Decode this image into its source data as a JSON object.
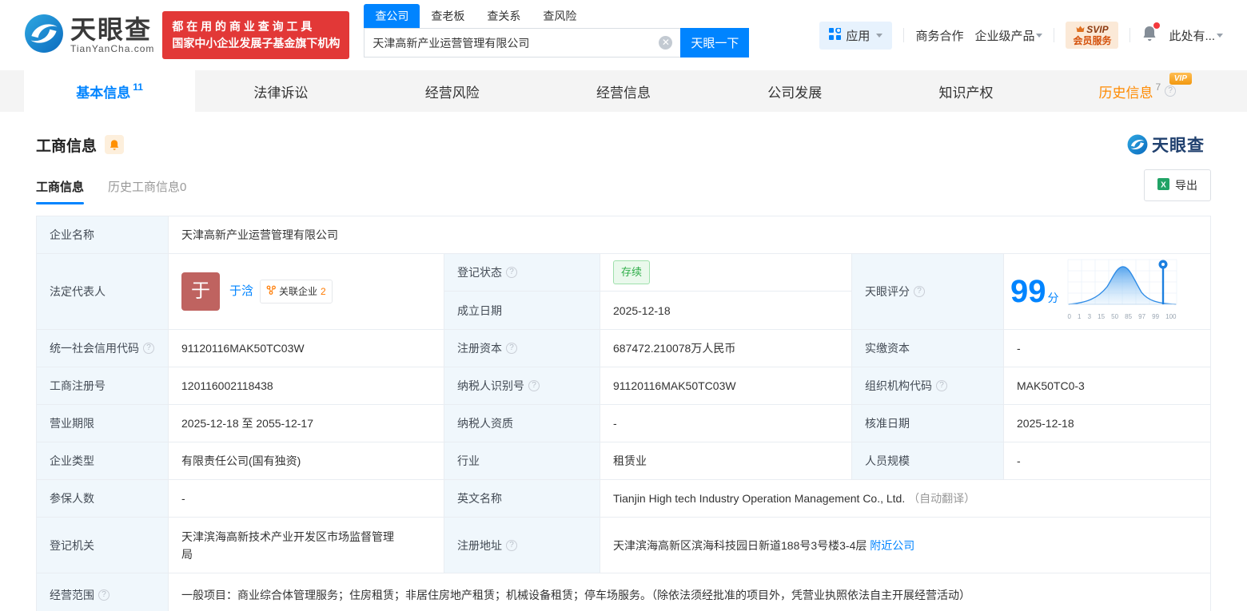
{
  "colors": {
    "accent": "#0084FF",
    "brand_red": "#E23837",
    "orange": "#FF8A00",
    "green": "#2FAE49",
    "label_bg": "#F0F7FC"
  },
  "header": {
    "brand": "天眼查",
    "brand_domain": "TianYanCha.com",
    "slogan_line1": "都 在 用 的 商 业 查 询 工 具",
    "slogan_line2": "国家中小企业发展子基金旗下机构",
    "search_tabs": [
      {
        "label": "查公司"
      },
      {
        "label": "查老板"
      },
      {
        "label": "查关系"
      },
      {
        "label": "查风险"
      }
    ],
    "search_value": "天津高新产业运营管理有限公司",
    "search_button": "天眼一下",
    "nav": {
      "apps": "应用",
      "cooperation": "商务合作",
      "enterprise": "企业级产品",
      "vip_line1": "SVIP",
      "vip_line2": "会员服务",
      "user": "此处有..."
    }
  },
  "tabs": [
    {
      "label": "基本信息",
      "count": "11"
    },
    {
      "label": "法律诉讼"
    },
    {
      "label": "经营风险"
    },
    {
      "label": "经营信息"
    },
    {
      "label": "公司发展"
    },
    {
      "label": "知识产权"
    },
    {
      "label": "历史信息",
      "count": "7",
      "vip": "VIP"
    }
  ],
  "section": {
    "title": "工商信息",
    "watermark": "天眼查",
    "subtab_active": "工商信息",
    "subtab_history": "历史工商信息",
    "subtab_history_count": "0",
    "export_label": "导出"
  },
  "table": {
    "name": {
      "label": "企业名称",
      "value": "天津高新产业运营管理有限公司"
    },
    "legal": {
      "label": "法定代表人",
      "avatar_char": "于",
      "name": "于浛",
      "related": "关联企业",
      "related_count": "2"
    },
    "status": {
      "label": "登记状态",
      "value": "存续"
    },
    "established": {
      "label": "成立日期",
      "value": "2025-12-18"
    },
    "score": {
      "label": "天眼评分",
      "value": "99",
      "unit": "分",
      "axis": [
        "0",
        "1",
        "3",
        "15",
        "50",
        "85",
        "97",
        "99",
        "100"
      ]
    },
    "credit_code": {
      "label": "统一社会信用代码",
      "value": "91120116MAK50TC03W"
    },
    "reg_capital": {
      "label": "注册资本",
      "value": "687472.210078万人民币"
    },
    "paid_capital": {
      "label": "实缴资本",
      "value": "-"
    },
    "reg_number": {
      "label": "工商注册号",
      "value": "120116002118438"
    },
    "taxpayer_id": {
      "label": "纳税人识别号",
      "value": "91120116MAK50TC03W"
    },
    "org_code": {
      "label": "组织机构代码",
      "value": "MAK50TC0-3"
    },
    "business_term": {
      "label": "营业期限",
      "value": "2025-12-18 至 2055-12-17"
    },
    "taxpayer_quality": {
      "label": "纳税人资质",
      "value": "-"
    },
    "approval_date": {
      "label": "核准日期",
      "value": "2025-12-18"
    },
    "company_type": {
      "label": "企业类型",
      "value": "有限责任公司(国有独资)"
    },
    "industry": {
      "label": "行业",
      "value": "租赁业"
    },
    "staff_size": {
      "label": "人员规模",
      "value": "-"
    },
    "insured": {
      "label": "参保人数",
      "value": "-"
    },
    "english_name": {
      "label": "英文名称",
      "value": "Tianjin High tech Industry Operation Management Co., Ltd.",
      "note": "（自动翻译）"
    },
    "reg_authority": {
      "label": "登记机关",
      "value": "天津滨海高新技术产业开发区市场监督管理局"
    },
    "reg_address": {
      "label": "注册地址",
      "value": "天津滨海高新区滨海科技园日新道188号3号楼3-4层",
      "link": "附近公司"
    },
    "business_scope": {
      "label": "经营范围",
      "value": "一般项目：商业综合体管理服务；住房租赁；非居住房地产租赁；机械设备租赁；停车场服务。（除依法须经批准的项目外，凭营业执照依法自主开展经营活动）"
    }
  }
}
